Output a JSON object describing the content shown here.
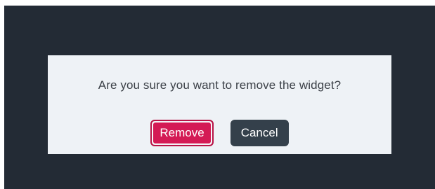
{
  "dialog": {
    "message": "Are you sure you want to remove the widget?",
    "remove_label": "Remove",
    "cancel_label": "Cancel"
  },
  "colors": {
    "backdrop": "#232b35",
    "dialog_background": "#eef2f6",
    "remove_button": "#d41a55",
    "cancel_button": "#34404b"
  }
}
